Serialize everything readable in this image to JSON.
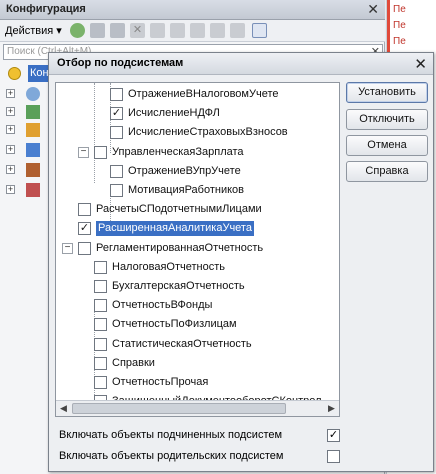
{
  "config_panel": {
    "title": "Конфигурация",
    "actions_label": "Действия",
    "search_placeholder": "Поиск (Ctrl+Alt+M)",
    "root_label": "Конфигурация",
    "toolbar_icons": [
      "add-icon",
      "edit-icon",
      "copy-icon",
      "delete-icon",
      "move-up-icon",
      "move-down-icon",
      "sort-up-icon",
      "sort-down-icon",
      "list-icon",
      "filter-icon"
    ],
    "tree_rows": [
      {
        "icon": "common-icon",
        "color": "#7fa8d9"
      },
      {
        "icon": "constants-icon",
        "color": "#5aa05a"
      },
      {
        "icon": "catalogs-icon",
        "color": "#e0a030"
      },
      {
        "icon": "documents-icon",
        "color": "#4a7fd0"
      },
      {
        "icon": "registers-icon",
        "color": "#b06030"
      },
      {
        "icon": "reports-icon",
        "color": "#c05050"
      },
      {
        "icon": "processings-icon",
        "color": "#6080b0"
      }
    ]
  },
  "editor": {
    "lines": [
      "Пе",
      "Пе",
      "Пе",
      "Пе"
    ]
  },
  "dialog": {
    "title": "Отбор по подсистемам",
    "buttons": {
      "install": "Установить",
      "disable": "Отключить",
      "cancel": "Отмена",
      "help": "Справка"
    },
    "tree": [
      {
        "label": "ОтражениеВНалоговомУчете",
        "checked": false,
        "level": 2,
        "expander": ""
      },
      {
        "label": "ИсчислениеНДФЛ",
        "checked": true,
        "level": 2,
        "expander": ""
      },
      {
        "label": "ИсчислениеСтраховыхВзносов",
        "checked": false,
        "level": 2,
        "expander": ""
      },
      {
        "label": "УправленческаяЗарплата",
        "checked": false,
        "level": 1,
        "expander": "−"
      },
      {
        "label": "ОтражениеВУпрУчете",
        "checked": false,
        "level": 2,
        "expander": ""
      },
      {
        "label": "МотивацияРаботников",
        "checked": false,
        "level": 2,
        "expander": ""
      },
      {
        "label": "РасчетыСПодотчетнымиЛицами",
        "checked": false,
        "level": 0,
        "expander": ""
      },
      {
        "label": "РасширеннаяАналитикаУчета",
        "checked": true,
        "level": 0,
        "expander": "",
        "selected": true
      },
      {
        "label": "РегламентированнаяОтчетность",
        "checked": false,
        "level": 0,
        "expander": "−"
      },
      {
        "label": "НалоговаяОтчетность",
        "checked": false,
        "level": 1,
        "expander": ""
      },
      {
        "label": "БухгалтерскаяОтчетность",
        "checked": false,
        "level": 1,
        "expander": ""
      },
      {
        "label": "ОтчетностьВФонды",
        "checked": false,
        "level": 1,
        "expander": ""
      },
      {
        "label": "ОтчетностьПоФизлицам",
        "checked": false,
        "level": 1,
        "expander": ""
      },
      {
        "label": "СтатистическаяОтчетность",
        "checked": false,
        "level": 1,
        "expander": ""
      },
      {
        "label": "Справки",
        "checked": false,
        "level": 1,
        "expander": ""
      },
      {
        "label": "ОтчетностьПрочая",
        "checked": false,
        "level": 1,
        "expander": ""
      },
      {
        "label": "ЗащищенныйДокументооборотСКонтрол",
        "checked": false,
        "level": 1,
        "expander": ""
      }
    ],
    "options": [
      {
        "label": "Включать объекты подчиненных подсистем",
        "checked": true
      },
      {
        "label": "Включать объекты родительских подсистем",
        "checked": false
      }
    ]
  }
}
